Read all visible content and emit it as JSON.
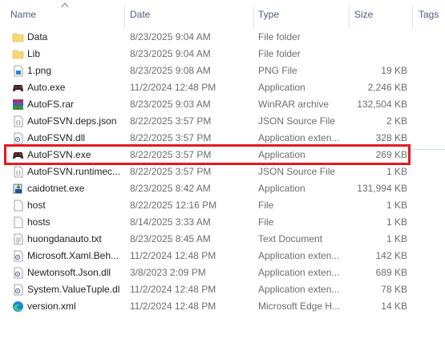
{
  "columns": {
    "name": "Name",
    "date": "Date",
    "type": "Type",
    "size": "Size",
    "tags": "Tags"
  },
  "files": [
    {
      "icon": "folder-icon",
      "name": "Data",
      "date": "8/23/2025 9:04 AM",
      "type": "File folder",
      "size": ""
    },
    {
      "icon": "folder-icon",
      "name": "Lib",
      "date": "8/23/2025 9:04 AM",
      "type": "File folder",
      "size": ""
    },
    {
      "icon": "png-file-icon",
      "name": "1.png",
      "date": "8/23/2025 9:08 AM",
      "type": "PNG File",
      "size": "19 KB"
    },
    {
      "icon": "gamepad-app-icon",
      "name": "Auto.exe",
      "date": "11/2/2024 12:48 PM",
      "type": "Application",
      "size": "2,246 KB"
    },
    {
      "icon": "winrar-archive-icon",
      "name": "AutoFS.rar",
      "date": "8/23/2025 9:03 AM",
      "type": "WinRAR archive",
      "size": "132,504 KB"
    },
    {
      "icon": "json-file-icon",
      "name": "AutoFSVN.deps.json",
      "date": "8/22/2025 3:57 PM",
      "type": "JSON Source File",
      "size": "2 KB"
    },
    {
      "icon": "dll-file-icon",
      "name": "AutoFSVN.dll",
      "date": "8/22/2025 3:57 PM",
      "type": "Application exten...",
      "size": "328 KB"
    },
    {
      "icon": "gamepad-app-icon",
      "name": "AutoFSVN.exe",
      "date": "8/22/2025 3:57 PM",
      "type": "Application",
      "size": "269 KB"
    },
    {
      "icon": "json-file-icon",
      "name": "AutoFSVN.runtimec...",
      "date": "8/22/2025 3:57 PM",
      "type": "JSON Source File",
      "size": "1 KB"
    },
    {
      "icon": "installer-app-icon",
      "name": "caidotnet.exe",
      "date": "8/23/2025 8:42 AM",
      "type": "Application",
      "size": "131,994 KB"
    },
    {
      "icon": "blank-file-icon",
      "name": "host",
      "date": "8/22/2025 12:16 PM",
      "type": "File",
      "size": "1 KB"
    },
    {
      "icon": "blank-file-icon",
      "name": "hosts",
      "date": "8/14/2025 3:33 AM",
      "type": "File",
      "size": "1 KB"
    },
    {
      "icon": "text-file-icon",
      "name": "huongdanauto.txt",
      "date": "8/23/2025 8:45 AM",
      "type": "Text Document",
      "size": "1 KB"
    },
    {
      "icon": "dll-file-icon",
      "name": "Microsoft.Xaml.Beh...",
      "date": "11/2/2024 12:48 PM",
      "type": "Application exten...",
      "size": "142 KB"
    },
    {
      "icon": "dll-file-icon",
      "name": "Newtonsoft.Json.dll",
      "date": "3/8/2023 2:09 PM",
      "type": "Application exten...",
      "size": "689 KB"
    },
    {
      "icon": "dll-file-icon",
      "name": "System.ValueTuple.dll",
      "date": "11/2/2024 12:48 PM",
      "type": "Application exten...",
      "size": "78 KB"
    },
    {
      "icon": "edge-xml-icon",
      "name": "version.xml",
      "date": "11/2/2024 12:48 PM",
      "type": "Microsoft Edge H...",
      "size": "14 KB"
    }
  ],
  "highlighted_file": "AutoFSVN.exe",
  "colors": {
    "highlight": "#e51920",
    "folder": "#f8d775",
    "header_text": "#4c607a"
  }
}
